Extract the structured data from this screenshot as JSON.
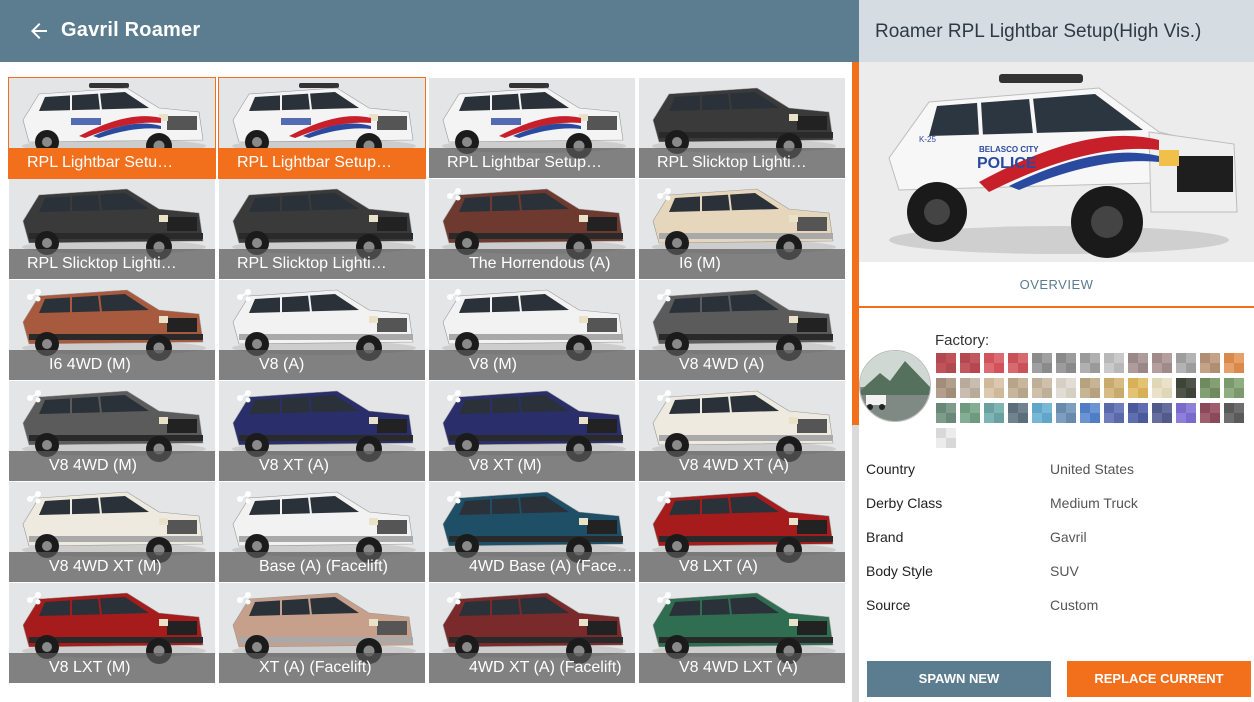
{
  "header": {
    "title": "Gavril Roamer"
  },
  "tiles": [
    {
      "label": "RPL Lightbar Setu…",
      "kind": "police",
      "icon": false,
      "selected": true
    },
    {
      "label": "RPL Lightbar Setup…",
      "kind": "police",
      "icon": false,
      "selected": true
    },
    {
      "label": "RPL Lightbar Setup…",
      "kind": "police",
      "icon": false
    },
    {
      "label": "RPL Slicktop Lighti…",
      "kind": "black",
      "icon": false
    },
    {
      "label": "RPL Slicktop Lighti…",
      "kind": "black",
      "icon": false
    },
    {
      "label": "RPL Slicktop Lighti…",
      "kind": "black",
      "icon": false
    },
    {
      "label": "The Horrendous (A)",
      "kind": "rust",
      "icon": true
    },
    {
      "label": "I6 (M)",
      "kind": "cream",
      "icon": true
    },
    {
      "label": "I6 4WD (M)",
      "kind": "copper",
      "icon": true
    },
    {
      "label": "V8 (A)",
      "kind": "white",
      "icon": true
    },
    {
      "label": "V8 (M)",
      "kind": "white",
      "icon": true
    },
    {
      "label": "V8 4WD (A)",
      "kind": "grey",
      "icon": true
    },
    {
      "label": "V8 4WD (M)",
      "kind": "grey",
      "icon": true
    },
    {
      "label": "V8 XT (A)",
      "kind": "navy",
      "icon": true
    },
    {
      "label": "V8 XT (M)",
      "kind": "navy",
      "icon": true
    },
    {
      "label": "V8 4WD XT (A)",
      "kind": "cream2",
      "icon": true
    },
    {
      "label": "V8 4WD XT (M)",
      "kind": "cream2",
      "icon": true
    },
    {
      "label": "Base (A) (Facelift)",
      "kind": "white",
      "icon": true
    },
    {
      "label": "4WD Base (A) (Face…",
      "kind": "teal",
      "icon": true
    },
    {
      "label": "V8 LXT (A)",
      "kind": "red",
      "icon": true
    },
    {
      "label": "V8 LXT (M)",
      "kind": "red",
      "icon": true
    },
    {
      "label": "XT (A) (Facelift)",
      "kind": "tan",
      "icon": true
    },
    {
      "label": "4WD XT (A) (Facelift)",
      "kind": "maroon",
      "icon": true
    },
    {
      "label": "V8 4WD LXT (A)",
      "kind": "green",
      "icon": true
    }
  ],
  "car_colors": {
    "police": "#f4f4f4",
    "black": "#3a3a3a",
    "rust": "#6e3a30",
    "cream": "#e6d6bc",
    "copper": "#a75a3e",
    "white": "#f2f2f2",
    "grey": "#5b5b5b",
    "navy": "#2a2f6b",
    "cream2": "#eeeadf",
    "teal": "#1e4f66",
    "red": "#a61c1c",
    "tan": "#c7a08c",
    "maroon": "#7a2a2a",
    "green": "#2f6e50"
  },
  "panel": {
    "title": "Roamer RPL Lightbar Setup(High Vis.)",
    "tab": "OVERVIEW",
    "paint_label": "Factory:",
    "details": [
      {
        "key": "Country",
        "value": "United States"
      },
      {
        "key": "Derby Class",
        "value": "Medium Truck"
      },
      {
        "key": "Brand",
        "value": "Gavril"
      },
      {
        "key": "Body Style",
        "value": "SUV"
      },
      {
        "key": "Source",
        "value": "Custom"
      }
    ],
    "spawn_label": "SPAWN NEW",
    "replace_label": "REPLACE CURRENT",
    "livery_text": [
      "K-25",
      "BELASCO CITY",
      "POLICE"
    ]
  },
  "swatches": [
    [
      "#b04a50",
      "#c0525a"
    ],
    [
      "#b5474f",
      "#c15860"
    ],
    [
      "#d2525c",
      "#dc6a72"
    ],
    [
      "#c9515a",
      "#d56a70"
    ],
    [
      "#8b8b8b",
      "#a0a0a0"
    ],
    [
      "#8a8a8a",
      "#9c9c9c"
    ],
    [
      "#9a9a9a",
      "#b0b0b0"
    ],
    [
      "#b8b8b8",
      "#c9c9c9"
    ],
    [
      "#9a8888",
      "#ae9c9c"
    ],
    [
      "#a08a8a",
      "#b59e9e"
    ],
    [
      "#9d9d9d",
      "#b3b3b3"
    ],
    [
      "#b08e74",
      "#c4a286"
    ],
    [
      "#d98a4a",
      "#e6a06a"
    ],
    [
      "#a28c7a",
      "#b49e8c"
    ],
    [
      "#b8ab9c",
      "#c8bdb0"
    ],
    [
      "#d0b89a",
      "#dcc8ae"
    ],
    [
      "#b8a488",
      "#c8b69c"
    ],
    [
      "#bfae98",
      "#cfc0ac"
    ],
    [
      "#d6d0c4",
      "#e2ddd4"
    ],
    [
      "#b6a27e",
      "#c6b494"
    ],
    [
      "#c8aa6c",
      "#d6bc84"
    ],
    [
      "#d8b058",
      "#e4c274"
    ],
    [
      "#e0d6b8",
      "#eae2c8"
    ],
    [
      "#3e4438",
      "#4e5448"
    ],
    [
      "#6e8a5e",
      "#82a072"
    ],
    [
      "#7a9a6e",
      "#8eae82"
    ],
    [
      "#6a8878",
      "#7e9c8c"
    ],
    [
      "#6f9a7f",
      "#83ae93"
    ],
    [
      "#6aa0a0",
      "#7eb4b4"
    ],
    [
      "#5c6e7a",
      "#70828e"
    ],
    [
      "#5fa6c8",
      "#76b8d6"
    ],
    [
      "#6a8aac",
      "#7e9ec0"
    ],
    [
      "#4f7ec4",
      "#6a94d2"
    ],
    [
      "#5a6aa8",
      "#6e7ebc"
    ],
    [
      "#4a5a9a",
      "#5e6eae"
    ],
    [
      "#525a8a",
      "#666e9e"
    ],
    [
      "#7a6acc",
      "#8e80d8"
    ],
    [
      "#8a4a5a",
      "#9e5e6e"
    ],
    [
      "#5a5a5a",
      "#6e6e6e"
    ],
    [
      "#d8d8d8",
      "#ececec"
    ]
  ]
}
